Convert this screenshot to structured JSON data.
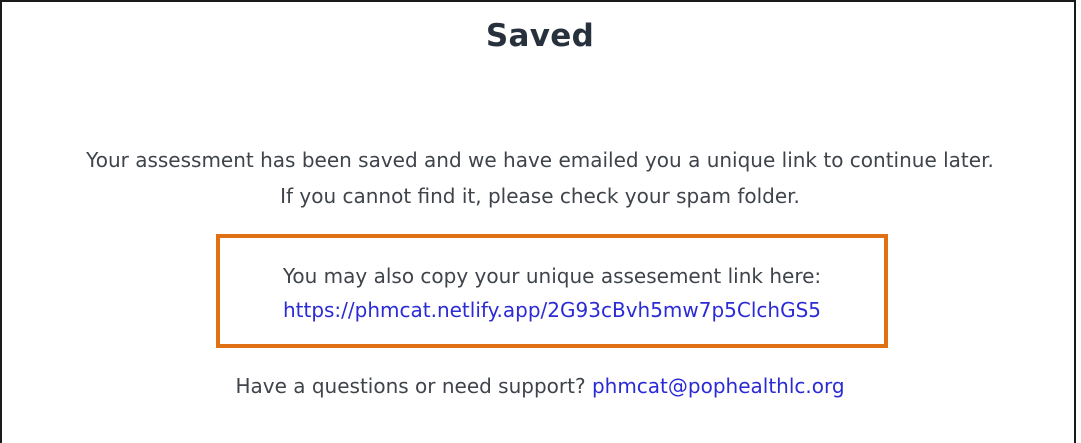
{
  "page": {
    "title": "Saved"
  },
  "message": {
    "line1": "Your assessment has been saved and we have emailed you a unique link to continue later.",
    "line2": "If you cannot find it, please check your spam folder."
  },
  "link_box": {
    "text": "You may also copy your unique assesement link here:",
    "url": "https://phmcat.netlify.app/2G93cBvh5mw7p5ClchGS5",
    "border_color": "#e07014"
  },
  "support": {
    "text": "Have a questions or need support?",
    "email": "phmcat@pophealthlc.org"
  },
  "colors": {
    "link": "#2b2bd6",
    "title": "#27303d",
    "body_text": "#3f444b"
  }
}
